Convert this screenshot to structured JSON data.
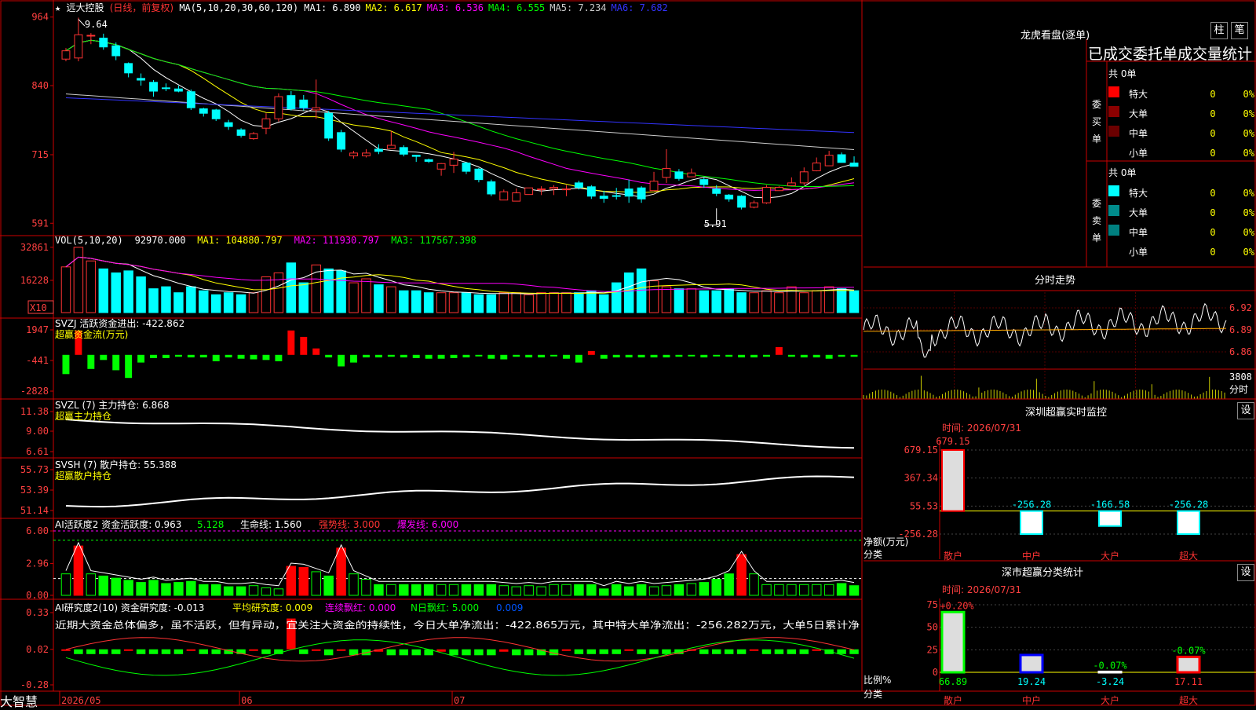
{
  "chart_data": {
    "type": "candlestick",
    "x_labels": [
      "2026/05",
      "06",
      "07"
    ],
    "x_label_index": [
      0,
      14,
      31
    ],
    "candles": [
      [
        888,
        903,
        884,
        908
      ],
      [
        890,
        932,
        884,
        963
      ],
      [
        930,
        931,
        915,
        935
      ],
      [
        926,
        910,
        905,
        934
      ],
      [
        912,
        894,
        886,
        918
      ],
      [
        880,
        863,
        855,
        882
      ],
      [
        853,
        850,
        840,
        862
      ],
      [
        846,
        830,
        820,
        850
      ],
      [
        836,
        835,
        830,
        844
      ],
      [
        834,
        830,
        828,
        840
      ],
      [
        829,
        800,
        796,
        833
      ],
      [
        798,
        790,
        784,
        800
      ],
      [
        796,
        780,
        776,
        798
      ],
      [
        773,
        766,
        760,
        778
      ],
      [
        760,
        750,
        746,
        763
      ],
      [
        744,
        753,
        742,
        756
      ],
      [
        763,
        780,
        752,
        790
      ],
      [
        780,
        820,
        775,
        826
      ],
      [
        822,
        798,
        795,
        830
      ],
      [
        814,
        800,
        795,
        823
      ],
      [
        796,
        800,
        780,
        851
      ],
      [
        790,
        745,
        740,
        794
      ],
      [
        755,
        725,
        720,
        760
      ],
      [
        713,
        718,
        708,
        722
      ],
      [
        713,
        718,
        710,
        725
      ],
      [
        725,
        721,
        716,
        734
      ],
      [
        726,
        732,
        729,
        758
      ],
      [
        728,
        716,
        712,
        732
      ],
      [
        714,
        712,
        702,
        715
      ],
      [
        706,
        703,
        700,
        708
      ],
      [
        689,
        699,
        677,
        700
      ],
      [
        696,
        707,
        682,
        720
      ],
      [
        700,
        685,
        680,
        702
      ],
      [
        689,
        670,
        665,
        691
      ],
      [
        666,
        644,
        640,
        670
      ],
      [
        633,
        648,
        637,
        652
      ],
      [
        631,
        646,
        640,
        654
      ],
      [
        643,
        655,
        649,
        651
      ],
      [
        653,
        653,
        642,
        658
      ],
      [
        653,
        656,
        642,
        660
      ],
      [
        653,
        653,
        640,
        660
      ],
      [
        664,
        656,
        652,
        668
      ],
      [
        657,
        640,
        635,
        660
      ],
      [
        640,
        636,
        628,
        650
      ],
      [
        641,
        640,
        634,
        655
      ],
      [
        653,
        640,
        628,
        670
      ],
      [
        655,
        635,
        628,
        658
      ],
      [
        650,
        667,
        660,
        684
      ],
      [
        674,
        690,
        664,
        725
      ],
      [
        684,
        672,
        668,
        689
      ],
      [
        675,
        682,
        675,
        690
      ],
      [
        670,
        661,
        655,
        674
      ],
      [
        653,
        645,
        640,
        660
      ],
      [
        642,
        635,
        630,
        644
      ],
      [
        640,
        620,
        616,
        642
      ],
      [
        620,
        628,
        618,
        632
      ],
      [
        628,
        656,
        626,
        660
      ],
      [
        650,
        656,
        652,
        658
      ],
      [
        659,
        664,
        658,
        674
      ],
      [
        664,
        684,
        660,
        692
      ],
      [
        686,
        700,
        685,
        710
      ],
      [
        695,
        714,
        696,
        722
      ],
      [
        715,
        701,
        705,
        719
      ],
      [
        700,
        694,
        694,
        712
      ]
    ],
    "price_axis": {
      "ticks": [
        "964",
        "840",
        "715",
        "591"
      ],
      "min": 580,
      "max": 975,
      "high_label": "9.64",
      "low_label": "5.91"
    },
    "ma_series": [
      {
        "name": "MA1",
        "value": "6.890",
        "color": "#ffffff"
      },
      {
        "name": "MA2",
        "value": "6.617",
        "color": "#ffff00"
      },
      {
        "name": "MA3",
        "value": "6.536",
        "color": "#ff00ff"
      },
      {
        "name": "MA4",
        "value": "6.555",
        "color": "#00ff00"
      },
      {
        "name": "MA5",
        "value": "7.234",
        "color": "#cccccc"
      },
      {
        "name": "MA6",
        "value": "7.682",
        "color": "#3333ff"
      }
    ],
    "volume": {
      "values": [
        23000,
        32861,
        26000,
        22000,
        20000,
        21000,
        18000,
        12000,
        13000,
        10000,
        13000,
        11000,
        9000,
        10000,
        9000,
        10000,
        18000,
        20000,
        25000,
        15000,
        24000,
        22000,
        21000,
        15000,
        17000,
        14000,
        13000,
        11000,
        11000,
        10000,
        10000,
        10000,
        10000,
        9000,
        9000,
        10000,
        10000,
        9000,
        10000,
        10000,
        10000,
        10000,
        11000,
        9000,
        15000,
        20000,
        22000,
        16000,
        13000,
        12000,
        12000,
        11000,
        11000,
        12000,
        10000,
        10000,
        11000,
        10000,
        13000,
        10000,
        11000,
        13000,
        12000,
        11000
      ],
      "ticks": [
        "32861",
        "16228"
      ],
      "multiplier": "X10",
      "header": [
        "VOL(5,10,20)",
        "92970.000",
        "MA1: 104880.797",
        "MA2: 111930.797",
        "MA3: 117567.398"
      ]
    },
    "svzj": {
      "header": [
        "SVZJ",
        "活跃资金进出: -422.862",
        "超赢资金流(万元)"
      ],
      "ticks": [
        "1947",
        "-441",
        "-2828"
      ],
      "values": [
        -1500,
        1900,
        -1100,
        -400,
        -1200,
        -1800,
        -600,
        -250,
        -250,
        -150,
        -200,
        -200,
        -500,
        -200,
        -300,
        -350,
        -400,
        -500,
        1900,
        1400,
        500,
        -200,
        -900,
        -600,
        -200,
        -200,
        -150,
        -200,
        -250,
        -300,
        -300,
        -250,
        -200,
        -100,
        -300,
        -350,
        -150,
        -200,
        -200,
        -100,
        -300,
        -600,
        300,
        -300,
        -200,
        -200,
        -200,
        -200,
        -200,
        -150,
        -100,
        -200,
        -100,
        -150,
        -200,
        -200,
        -150,
        600,
        -150,
        -200,
        -200,
        -300,
        -150,
        -150
      ]
    },
    "svzl": {
      "header": [
        "SVZL  (7)  主力持仓: 6.868",
        "超赢主力持仓"
      ],
      "ticks": [
        "11.38",
        "9.00",
        "6.61"
      ]
    },
    "svsh": {
      "header": [
        "SVSH  (7)  散户持仓: 55.388",
        "超赢散户持仓"
      ],
      "ticks": [
        "55.73",
        "53.39",
        "51.14"
      ]
    },
    "ai_huoyue": {
      "header": [
        "AI活跃度2 资金活跃度: 0.963",
        "5.128",
        "生命线: 1.560",
        "强势线: 3.000",
        "爆发线: 6.000"
      ],
      "ticks": [
        "6.00",
        "2.96",
        "0.00"
      ],
      "values": [
        2.0,
        4.6,
        2.0,
        1.8,
        1.6,
        1.4,
        1.2,
        1.4,
        1.1,
        1.2,
        1.3,
        1.0,
        1.0,
        0.8,
        0.8,
        0.9,
        0.7,
        0.6,
        2.7,
        2.6,
        2.2,
        1.8,
        4.4,
        2.0,
        1.5,
        1.0,
        1.0,
        1.0,
        1.0,
        1.0,
        1.0,
        1.0,
        1.0,
        1.0,
        1.0,
        0.9,
        0.8,
        0.9,
        0.8,
        1.0,
        1.0,
        1.0,
        1.0,
        0.6,
        1.0,
        0.8,
        1.0,
        0.8,
        0.9,
        1.0,
        1.1,
        1.2,
        1.5,
        2.0,
        3.8,
        2.0,
        1.0,
        1.0,
        1.0,
        1.0,
        1.0,
        1.0,
        1.1,
        0.9
      ]
    },
    "ai_yanjiu": {
      "header": [
        "AI研究度2(10) 资金研究度: -0.013",
        "平均研究度: 0.009",
        "连续飘红: 0.000",
        "N日飘红: 5.000",
        "0.009"
      ],
      "ticks": [
        "0.33",
        "0.02",
        "-0.28"
      ],
      "comment": "近期大资金总体偏多，虽不活跃，但有异动，宜关注大资金的持续性，今日大单净流出：-422.865万元，其中特大单净流出：-256.282万元，大单5日累计净"
    }
  },
  "header_line": {
    "star": "★",
    "name": "远大控股",
    "period": "(日线，前复权)",
    "ma_label": "MA(5,10,20,30,60,120)"
  },
  "bottom_bar": {
    "app": "大智慧"
  },
  "right_panel": {
    "longhu_title": "龙虎看盘(逐单)",
    "btn_zhu": "柱",
    "btn_bi": "笔",
    "table_title": "已成交委托单成交量统计",
    "buy": {
      "side_label": "委买单",
      "count": "共 0单",
      "rows": [
        {
          "label": "特大",
          "v": "0",
          "p": "0%",
          "color": "#ff0000"
        },
        {
          "label": "大单",
          "v": "0",
          "p": "0%",
          "color": "#8b0000"
        },
        {
          "label": "中单",
          "v": "0",
          "p": "0%",
          "color": "#6b0000"
        },
        {
          "label": "小单",
          "v": "0",
          "p": "0%",
          "color": "#000000"
        }
      ]
    },
    "sell": {
      "side_label": "委卖单",
      "count": "共 0单",
      "rows": [
        {
          "label": "特大",
          "v": "0",
          "p": "0%",
          "color": "#00ffff"
        },
        {
          "label": "大单",
          "v": "0",
          "p": "0%",
          "color": "#008b8b"
        },
        {
          "label": "中单",
          "v": "0",
          "p": "0%",
          "color": "#008080"
        },
        {
          "label": "小单",
          "v": "0",
          "p": "0%",
          "color": "#000000"
        }
      ]
    },
    "fenshi_title": "分时走势",
    "fenshi_ticks": [
      "6.92",
      "6.89",
      "6.86"
    ],
    "fenshi_vol_label": "3808",
    "fenshi_vol_unit": "分时",
    "sz_title": "深圳超赢实时监控",
    "sz_btn": "设",
    "sz_time": "时间: 2026/07/31",
    "sz_ticks": [
      "679.15",
      "367.34",
      "55.53",
      "-256.28"
    ],
    "sz_top": "679.15",
    "sz_bars": [
      {
        "label": "散户",
        "value": 679.15,
        "text": ""
      },
      {
        "label": "中户",
        "value": -256.28,
        "text": "-256.28"
      },
      {
        "label": "大户",
        "value": -166.58,
        "text": "-166.58"
      },
      {
        "label": "超大",
        "value": -256.28,
        "text": "-256.28"
      }
    ],
    "sz_axis_label": "净额(万元)",
    "sz_cat_label": "分类",
    "fl_title": "深市超赢分类统计",
    "fl_btn": "设",
    "fl_time": "时间: 2026/07/31",
    "fl_ticks": [
      "75",
      "50",
      "25",
      "0"
    ],
    "fl_bars": [
      {
        "label": "散户",
        "value": 66.89,
        "pct": "+0.20%",
        "color": "#00ff00"
      },
      {
        "label": "中户",
        "value": 19.24,
        "pct": "",
        "color": "#0000ff"
      },
      {
        "label": "大户",
        "value": -3.24,
        "pct": "-0.07%",
        "color": "#ffffff"
      },
      {
        "label": "超大",
        "value": 17.11,
        "pct": "-0.07%",
        "color": "#ff0000"
      }
    ],
    "fl_values": [
      "66.89",
      "19.24",
      "-3.24",
      "17.11"
    ],
    "fl_axis_label": "比例%",
    "fl_cat_label": "分类"
  },
  "colors": {
    "up": "#ff3333",
    "down": "#00ffff",
    "grid": "#cc0000",
    "axis_text": "#ff4040",
    "green": "#00ff00"
  }
}
